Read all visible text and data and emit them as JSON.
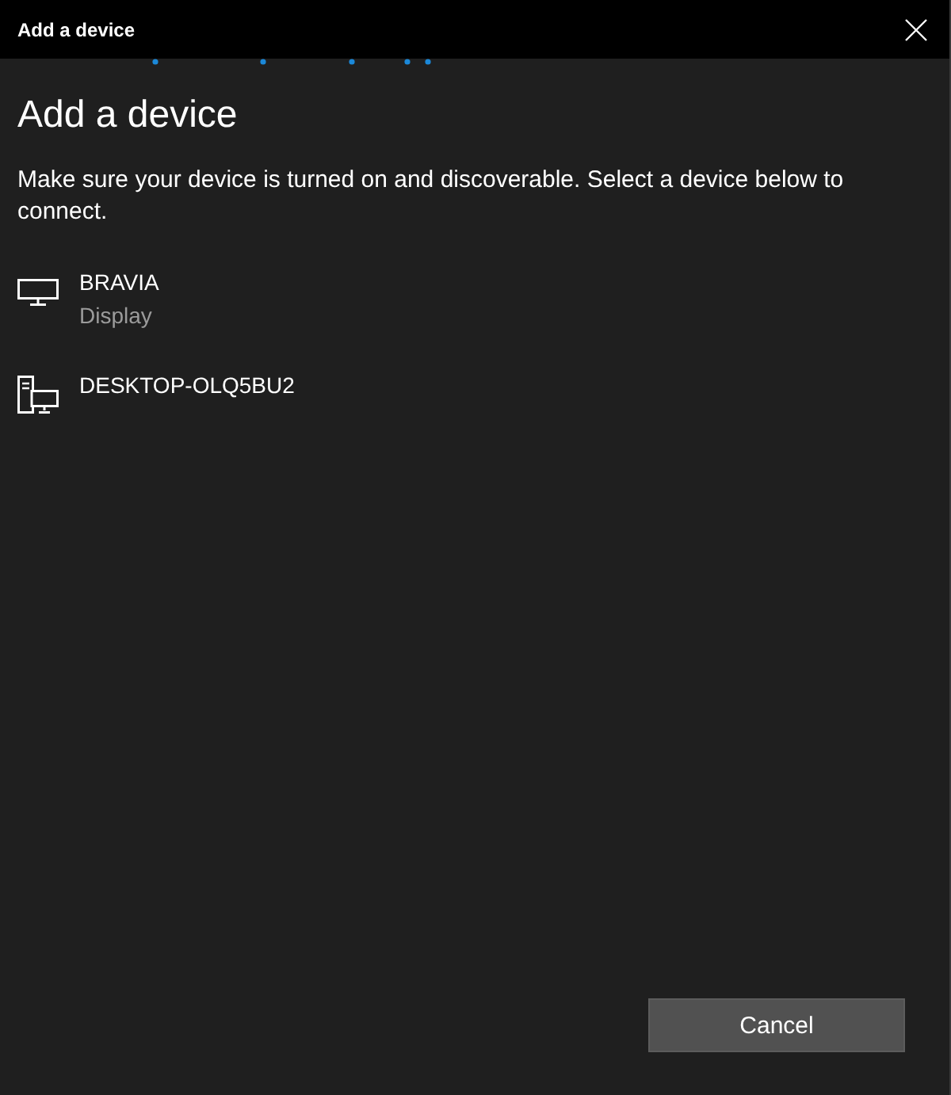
{
  "window": {
    "title": "Add a device"
  },
  "heading": "Add a device",
  "instructions": "Make sure your device is turned on and discoverable. Select a device below to connect.",
  "devices": [
    {
      "kind": "display",
      "name": "BRAVIA",
      "type": "Display"
    },
    {
      "kind": "computer",
      "name": "DESKTOP-OLQ5BU2"
    }
  ],
  "buttons": [
    {
      "label": "Cancel"
    }
  ]
}
